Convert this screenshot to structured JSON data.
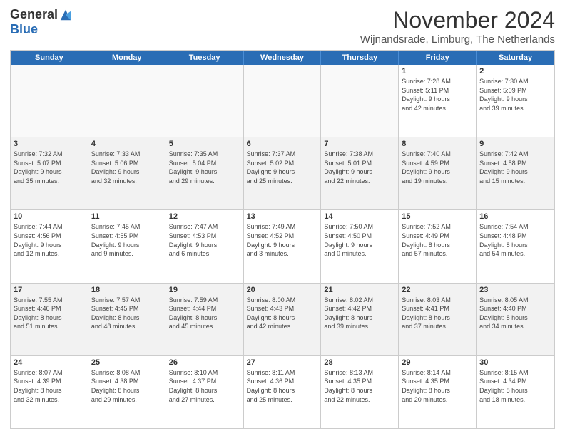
{
  "logo": {
    "general": "General",
    "blue": "Blue"
  },
  "title": "November 2024",
  "location": "Wijnandsrade, Limburg, The Netherlands",
  "header_days": [
    "Sunday",
    "Monday",
    "Tuesday",
    "Wednesday",
    "Thursday",
    "Friday",
    "Saturday"
  ],
  "weeks": [
    [
      {
        "day": "",
        "info": ""
      },
      {
        "day": "",
        "info": ""
      },
      {
        "day": "",
        "info": ""
      },
      {
        "day": "",
        "info": ""
      },
      {
        "day": "",
        "info": ""
      },
      {
        "day": "1",
        "info": "Sunrise: 7:28 AM\nSunset: 5:11 PM\nDaylight: 9 hours\nand 42 minutes."
      },
      {
        "day": "2",
        "info": "Sunrise: 7:30 AM\nSunset: 5:09 PM\nDaylight: 9 hours\nand 39 minutes."
      }
    ],
    [
      {
        "day": "3",
        "info": "Sunrise: 7:32 AM\nSunset: 5:07 PM\nDaylight: 9 hours\nand 35 minutes."
      },
      {
        "day": "4",
        "info": "Sunrise: 7:33 AM\nSunset: 5:06 PM\nDaylight: 9 hours\nand 32 minutes."
      },
      {
        "day": "5",
        "info": "Sunrise: 7:35 AM\nSunset: 5:04 PM\nDaylight: 9 hours\nand 29 minutes."
      },
      {
        "day": "6",
        "info": "Sunrise: 7:37 AM\nSunset: 5:02 PM\nDaylight: 9 hours\nand 25 minutes."
      },
      {
        "day": "7",
        "info": "Sunrise: 7:38 AM\nSunset: 5:01 PM\nDaylight: 9 hours\nand 22 minutes."
      },
      {
        "day": "8",
        "info": "Sunrise: 7:40 AM\nSunset: 4:59 PM\nDaylight: 9 hours\nand 19 minutes."
      },
      {
        "day": "9",
        "info": "Sunrise: 7:42 AM\nSunset: 4:58 PM\nDaylight: 9 hours\nand 15 minutes."
      }
    ],
    [
      {
        "day": "10",
        "info": "Sunrise: 7:44 AM\nSunset: 4:56 PM\nDaylight: 9 hours\nand 12 minutes."
      },
      {
        "day": "11",
        "info": "Sunrise: 7:45 AM\nSunset: 4:55 PM\nDaylight: 9 hours\nand 9 minutes."
      },
      {
        "day": "12",
        "info": "Sunrise: 7:47 AM\nSunset: 4:53 PM\nDaylight: 9 hours\nand 6 minutes."
      },
      {
        "day": "13",
        "info": "Sunrise: 7:49 AM\nSunset: 4:52 PM\nDaylight: 9 hours\nand 3 minutes."
      },
      {
        "day": "14",
        "info": "Sunrise: 7:50 AM\nSunset: 4:50 PM\nDaylight: 9 hours\nand 0 minutes."
      },
      {
        "day": "15",
        "info": "Sunrise: 7:52 AM\nSunset: 4:49 PM\nDaylight: 8 hours\nand 57 minutes."
      },
      {
        "day": "16",
        "info": "Sunrise: 7:54 AM\nSunset: 4:48 PM\nDaylight: 8 hours\nand 54 minutes."
      }
    ],
    [
      {
        "day": "17",
        "info": "Sunrise: 7:55 AM\nSunset: 4:46 PM\nDaylight: 8 hours\nand 51 minutes."
      },
      {
        "day": "18",
        "info": "Sunrise: 7:57 AM\nSunset: 4:45 PM\nDaylight: 8 hours\nand 48 minutes."
      },
      {
        "day": "19",
        "info": "Sunrise: 7:59 AM\nSunset: 4:44 PM\nDaylight: 8 hours\nand 45 minutes."
      },
      {
        "day": "20",
        "info": "Sunrise: 8:00 AM\nSunset: 4:43 PM\nDaylight: 8 hours\nand 42 minutes."
      },
      {
        "day": "21",
        "info": "Sunrise: 8:02 AM\nSunset: 4:42 PM\nDaylight: 8 hours\nand 39 minutes."
      },
      {
        "day": "22",
        "info": "Sunrise: 8:03 AM\nSunset: 4:41 PM\nDaylight: 8 hours\nand 37 minutes."
      },
      {
        "day": "23",
        "info": "Sunrise: 8:05 AM\nSunset: 4:40 PM\nDaylight: 8 hours\nand 34 minutes."
      }
    ],
    [
      {
        "day": "24",
        "info": "Sunrise: 8:07 AM\nSunset: 4:39 PM\nDaylight: 8 hours\nand 32 minutes."
      },
      {
        "day": "25",
        "info": "Sunrise: 8:08 AM\nSunset: 4:38 PM\nDaylight: 8 hours\nand 29 minutes."
      },
      {
        "day": "26",
        "info": "Sunrise: 8:10 AM\nSunset: 4:37 PM\nDaylight: 8 hours\nand 27 minutes."
      },
      {
        "day": "27",
        "info": "Sunrise: 8:11 AM\nSunset: 4:36 PM\nDaylight: 8 hours\nand 25 minutes."
      },
      {
        "day": "28",
        "info": "Sunrise: 8:13 AM\nSunset: 4:35 PM\nDaylight: 8 hours\nand 22 minutes."
      },
      {
        "day": "29",
        "info": "Sunrise: 8:14 AM\nSunset: 4:35 PM\nDaylight: 8 hours\nand 20 minutes."
      },
      {
        "day": "30",
        "info": "Sunrise: 8:15 AM\nSunset: 4:34 PM\nDaylight: 8 hours\nand 18 minutes."
      }
    ]
  ]
}
